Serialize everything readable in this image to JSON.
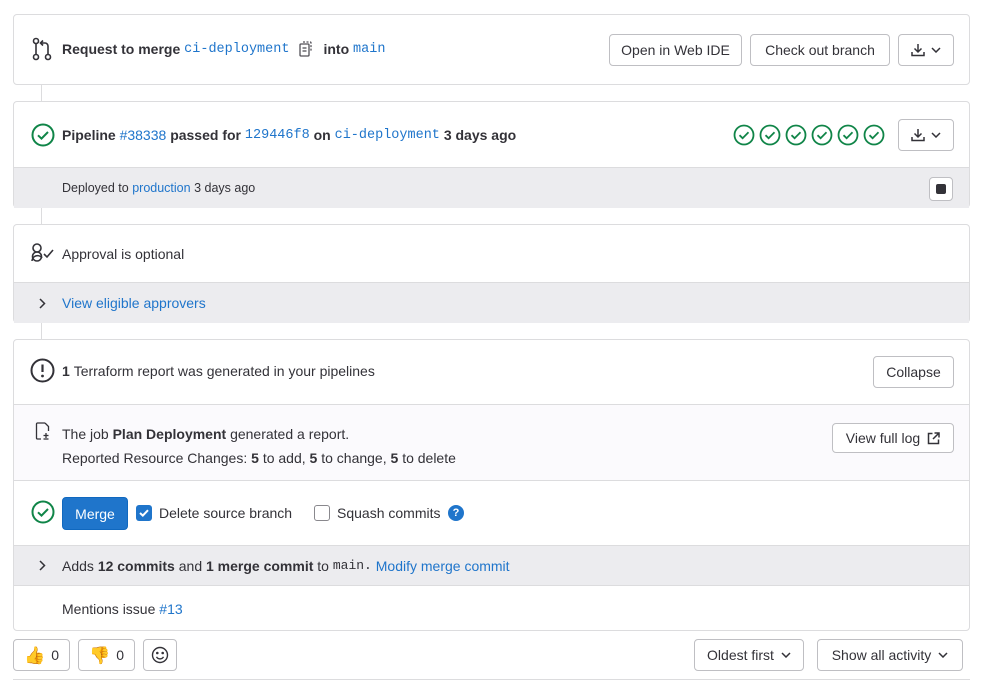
{
  "merge_header": {
    "prefix": "Request to merge",
    "source_branch": "ci-deployment",
    "into": "into",
    "target_branch": "main",
    "open_web_ide": "Open in Web IDE",
    "check_out_branch": "Check out branch"
  },
  "pipeline": {
    "label": "Pipeline",
    "id": "#38338",
    "passed_for": "passed for",
    "commit": "129446f8",
    "on": "on",
    "branch": "ci-deployment",
    "time": "3 days ago",
    "stage_count": 6,
    "status_color": "#108548"
  },
  "deployment": {
    "prefix": "Deployed to",
    "environment": "production",
    "time": "3 days ago"
  },
  "approval": {
    "text": "Approval is optional",
    "view_approvers": "View eligible approvers"
  },
  "terraform": {
    "count": "1",
    "text": "Terraform report was generated in your pipelines",
    "collapse": "Collapse",
    "job_prefix": "The job",
    "job_name": "Plan Deployment",
    "job_suffix": "generated a report.",
    "changes_prefix": "Reported Resource Changes:",
    "add_count": "5",
    "add_label": "to add,",
    "change_count": "5",
    "change_label": "to change,",
    "delete_count": "5",
    "delete_label": "to delete",
    "view_full_log": "View full log"
  },
  "merge": {
    "button": "Merge",
    "delete_source_branch": "Delete source branch",
    "delete_checked": true,
    "squash_commits": "Squash commits",
    "squash_checked": false
  },
  "commits": {
    "adds": "Adds",
    "commit_count": "12 commits",
    "and": "and",
    "merge_commit_count": "1 merge commit",
    "to": "to",
    "branch": "main.",
    "modify": "Modify merge commit"
  },
  "mentions": {
    "prefix": "Mentions issue",
    "issue": "#13"
  },
  "footer": {
    "thumbs_up_count": "0",
    "thumbs_down_count": "0",
    "sort": "Oldest first",
    "filter": "Show all activity"
  },
  "colors": {
    "link": "#1f75cb",
    "success": "#108548",
    "primary": "#1f75cb",
    "border": "#dcdcde"
  }
}
